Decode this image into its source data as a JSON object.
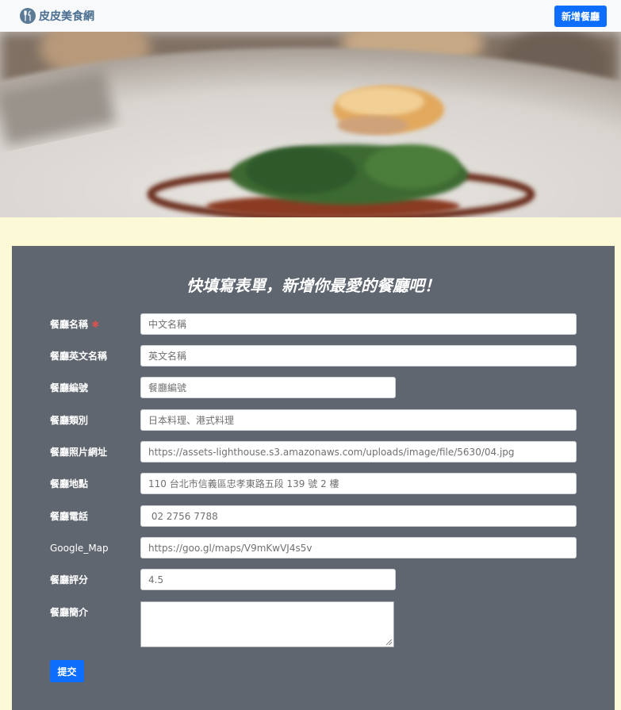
{
  "navbar": {
    "brand": "皮皮美食網",
    "logo_icon": "fork-knife-icon",
    "add_button": "新增餐廳",
    "accent": "#0d6efd"
  },
  "form": {
    "title": "快填寫表單，新增你最愛的餐廳吧！",
    "required_mark": "✱",
    "fields": [
      {
        "label": "餐廳名稱",
        "placeholder": "中文名稱",
        "value": ""
      },
      {
        "label": "餐廳英文名稱",
        "placeholder": "英文名稱",
        "value": ""
      },
      {
        "label": "餐廳編號",
        "placeholder": "餐廳編號",
        "value": ""
      },
      {
        "label": "餐廳類別",
        "placeholder": "日本料理、港式料理",
        "value": ""
      },
      {
        "label": "餐廳照片網址",
        "placeholder": "https://assets-lighthouse.s3.amazonaws.com/uploads/image/file/5630/04.jpg",
        "value": ""
      },
      {
        "label": "餐廳地點",
        "placeholder": "110 台北市信義區忠孝東路五段 139 號 2 樓",
        "value": ""
      },
      {
        "label": "餐廳電話",
        "placeholder": " 02 2756 7788",
        "value": ""
      },
      {
        "label": "Google_Map",
        "placeholder": "https://goo.gl/maps/V9mKwVJ4s5v",
        "value": ""
      },
      {
        "label": "餐廳評分",
        "placeholder": "4.5",
        "value": ""
      },
      {
        "label": "餐廳簡介",
        "placeholder": "",
        "value": ""
      }
    ],
    "submit": "提交"
  }
}
